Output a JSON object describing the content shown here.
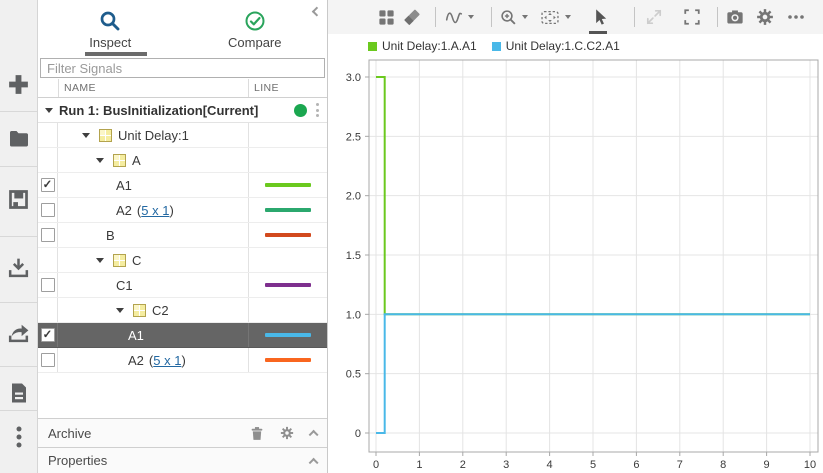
{
  "rail": {
    "items": [
      {
        "icon": "plus-icon",
        "name": "new"
      },
      {
        "icon": "folder-icon",
        "name": "open"
      },
      {
        "icon": "save-icon",
        "name": "save"
      },
      {
        "icon": "import-icon",
        "name": "import"
      },
      {
        "icon": "export-icon",
        "name": "export"
      },
      {
        "icon": "report-icon",
        "name": "report"
      },
      {
        "icon": "kebab-icon",
        "name": "more"
      }
    ]
  },
  "tabs": {
    "inspect": {
      "label": "Inspect",
      "icon": "magnifier-icon",
      "active": true
    },
    "compare": {
      "label": "Compare",
      "icon": "check-circle-icon",
      "active": false
    },
    "collapse_icon": "chevron-left-icon"
  },
  "filter": {
    "placeholder": "Filter Signals"
  },
  "table": {
    "columns": [
      "NAME",
      "LINE"
    ]
  },
  "tree": {
    "rows": [
      {
        "label": "Run 1: BusInitialization[Current]",
        "type": "run",
        "status_color": "#1ba750"
      },
      {
        "label": "Unit Delay:1",
        "type": "bus",
        "level": 1
      },
      {
        "label": "A",
        "type": "bus",
        "level": 2
      },
      {
        "label": "A1",
        "type": "signal",
        "level": 3,
        "checked": true,
        "line_color": "#6bc91e"
      },
      {
        "label": "A2",
        "dims_link": "5 x 1",
        "type": "signal",
        "level": 3,
        "checked": false,
        "line_color": "#2ba86e"
      },
      {
        "label": "B",
        "type": "signal",
        "level": 2,
        "checked": false,
        "line_color": "#d2491d"
      },
      {
        "label": "C",
        "type": "bus",
        "level": 2
      },
      {
        "label": "C1",
        "type": "signal",
        "level": 3,
        "checked": false,
        "line_color": "#7e2f8e"
      },
      {
        "label": "C2",
        "type": "bus",
        "level": 3
      },
      {
        "label": "A1",
        "type": "signal",
        "level": 4,
        "checked": true,
        "selected": true,
        "line_color": "#49b8e8"
      },
      {
        "label": "A2",
        "dims_link": "5 x 1",
        "type": "signal",
        "level": 4,
        "checked": false,
        "line_color": "#f9661f"
      }
    ]
  },
  "archive": {
    "label": "Archive",
    "icons": [
      "trash-icon",
      "gear-icon",
      "chevron-up-icon"
    ]
  },
  "properties": {
    "label": "Properties",
    "icons": [
      "chevron-up-icon"
    ]
  },
  "plot_toolbar": {
    "buttons": [
      "subplot-layout",
      "clear-plots",
      "signal-trace",
      "zoom-in",
      "fit-to-view",
      "pointer",
      "resize-diagonal",
      "fullscreen",
      "snapshot",
      "settings",
      "more"
    ]
  },
  "legend": [
    {
      "label": "Unit Delay:1.A.A1",
      "color": "#6bc91e"
    },
    {
      "label": "Unit Delay:1.C.C2.A1",
      "color": "#49b8e8"
    }
  ],
  "chart_data": {
    "type": "line",
    "title": "",
    "xlabel": "",
    "ylabel": "",
    "xlim": [
      0,
      10
    ],
    "ylim": [
      0,
      3
    ],
    "xticks": [
      0,
      1,
      2,
      3,
      4,
      5,
      6,
      7,
      8,
      9,
      10
    ],
    "yticks": [
      0,
      0.5,
      1.0,
      1.5,
      2.0,
      2.5,
      3.0
    ],
    "grid": true,
    "legend_position": "top-left",
    "series": [
      {
        "name": "Unit Delay:1.A.A1",
        "color": "#6bc91e",
        "points": [
          [
            0,
            3
          ],
          [
            0.2,
            3
          ],
          [
            0.2,
            1
          ],
          [
            10,
            1
          ]
        ]
      },
      {
        "name": "Unit Delay:1.C.C2.A1",
        "color": "#49b8e8",
        "points": [
          [
            0,
            0
          ],
          [
            0.2,
            0
          ],
          [
            0.2,
            1
          ],
          [
            10,
            1
          ]
        ]
      }
    ]
  }
}
